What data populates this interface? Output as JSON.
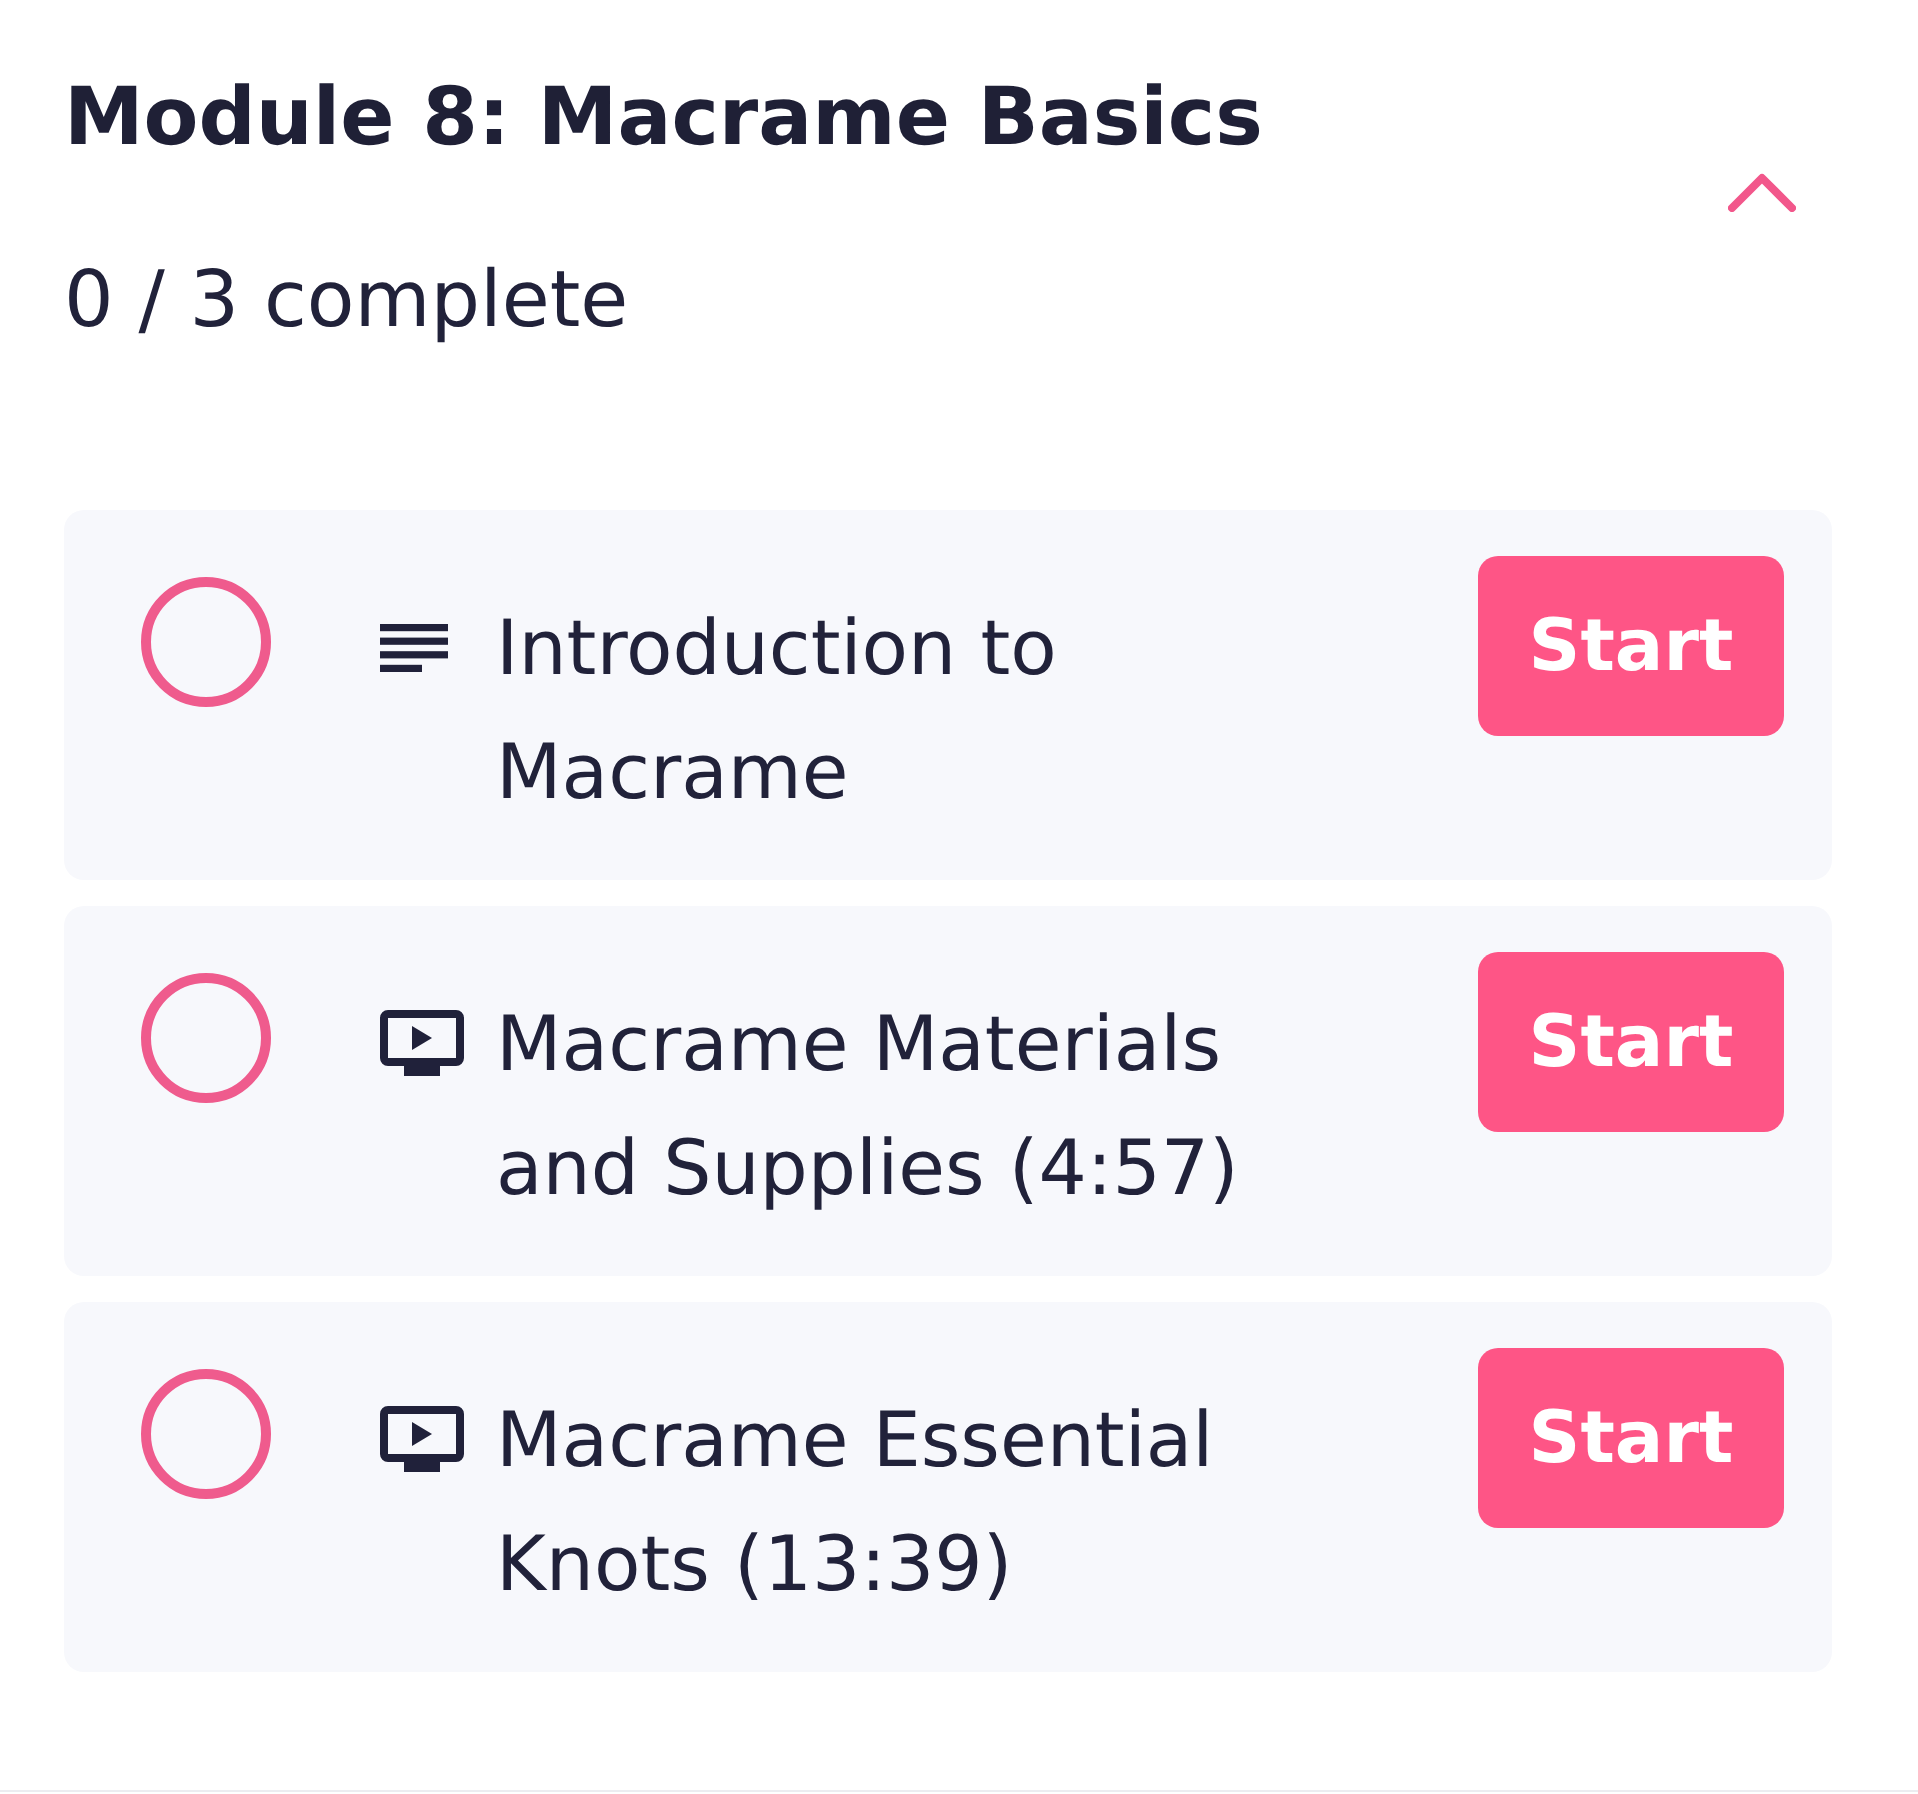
{
  "module": {
    "title": "Module 8: Macrame Basics",
    "progress": "0 / 3 complete",
    "expanded": true
  },
  "lessons": [
    {
      "kind": "article",
      "title": "Introduction to Macrame",
      "completed": false,
      "action": "Start"
    },
    {
      "kind": "video",
      "title": "Macrame Materials and Supplies (4:57)",
      "completed": false,
      "action": "Start"
    },
    {
      "kind": "video",
      "title": "Macrame Essential Knots (13:39)",
      "completed": false,
      "action": "Start"
    }
  ]
}
